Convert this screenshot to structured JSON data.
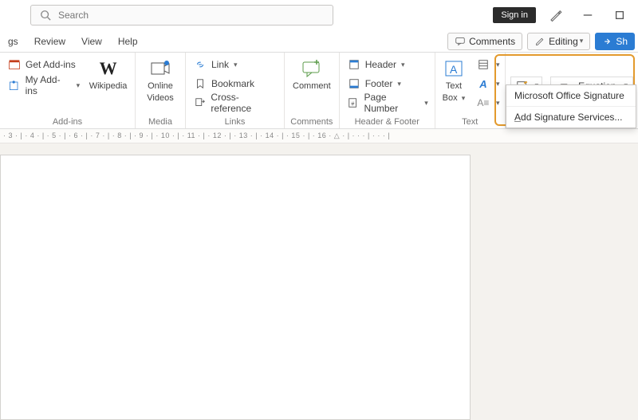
{
  "titlebar": {
    "search_placeholder": "Search",
    "signin": "Sign in"
  },
  "tabs": {
    "t0": "gs",
    "t1": "Review",
    "t2": "View",
    "t3": "Help"
  },
  "rightpills": {
    "comments": "Comments",
    "editing": "Editing",
    "share": "Sh"
  },
  "ribbon": {
    "addins": {
      "get": "Get Add-ins",
      "my": "My Add-ins",
      "wikipedia": "Wikipedia",
      "label": "Add-ins"
    },
    "media": {
      "videos_l1": "Online",
      "videos_l2": "Videos",
      "label": "Media"
    },
    "links": {
      "link": "Link",
      "bookmark": "Bookmark",
      "xref": "Cross-reference",
      "label": "Links"
    },
    "comments": {
      "comment": "Comment",
      "label": "Comments"
    },
    "hf": {
      "header": "Header",
      "footer": "Footer",
      "pagenum": "Page Number",
      "label": "Header & Footer"
    },
    "text": {
      "textbox_l1": "Text",
      "textbox_l2": "Box",
      "label": "Text"
    },
    "symbols": {
      "equation": "Equation"
    }
  },
  "dropdown": {
    "item1": "Microsoft Office Signature",
    "item2_prefix": "A",
    "item2_rest": "dd Signature Services..."
  },
  "ruler_text": "· 3 · | · 4 · | · 5 · | · 6 · | · 7 · | · 8 · | · 9 · | · 10 · | · 11 · | · 12 · | · 13 · | · 14 · | · 15 · | · 16 · △ · | · · · | · · · |"
}
